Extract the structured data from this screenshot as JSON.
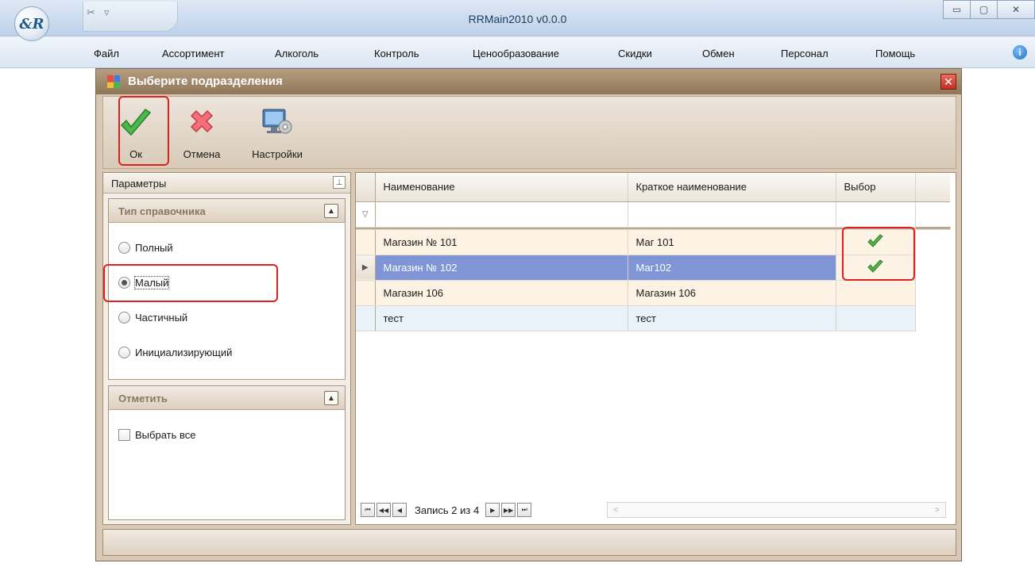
{
  "window": {
    "title": "RRMain2010 v0.0.0",
    "logo_text": "&R",
    "qat_icons": [
      "settings-plug-icon",
      "dropdown-arrow-icon"
    ],
    "controls": {
      "minimize": "▭",
      "maximize": "▢",
      "close": "✕"
    }
  },
  "menu": {
    "items": [
      "Файл",
      "Ассортимент",
      "Алкоголь",
      "Контроль",
      "Ценообразование",
      "Скидки",
      "Обмен",
      "Персонал",
      "Помощь"
    ]
  },
  "dialog": {
    "title": "Выберите подразделения",
    "close_label": "✕",
    "toolbar": {
      "ok_label": "Ок",
      "cancel_label": "Отмена",
      "settings_label": "Настройки"
    },
    "params": {
      "header": "Параметры",
      "pin": "⊥",
      "type_group": {
        "title": "Тип справочника",
        "options": [
          "Полный",
          "Малый",
          "Частичный",
          "Инициализирующий"
        ],
        "selected": "Малый"
      },
      "mark_group": {
        "title": "Отметить",
        "select_all_label": "Выбрать все",
        "select_all_checked": false
      }
    },
    "grid": {
      "columns": [
        "Наименование",
        "Краткое наименование",
        "Выбор"
      ],
      "filter_icon": "▽",
      "rows": [
        {
          "name": "Магазин № 101",
          "short": "Маг 101",
          "selected": true
        },
        {
          "name": "Магазин № 102",
          "short": "Маг102",
          "selected": true
        },
        {
          "name": "Магазин 106",
          "short": "Магазин 106",
          "selected": false
        },
        {
          "name": "тест",
          "short": "тест",
          "selected": false
        }
      ],
      "current_row_index": 1,
      "current_row_marker": "▶",
      "navigator": {
        "record_text": "Запись 2 из 4",
        "buttons": [
          "⏮",
          "◀◀",
          "◀",
          "▶",
          "▶▶",
          "⏭"
        ]
      },
      "scroll_left": "<",
      "scroll_right": ">"
    }
  },
  "colors": {
    "highlight": "#e02020",
    "selected_row": "#7f95d6",
    "check_green": "#3aa63a",
    "dialog_title": "#8f7659"
  }
}
